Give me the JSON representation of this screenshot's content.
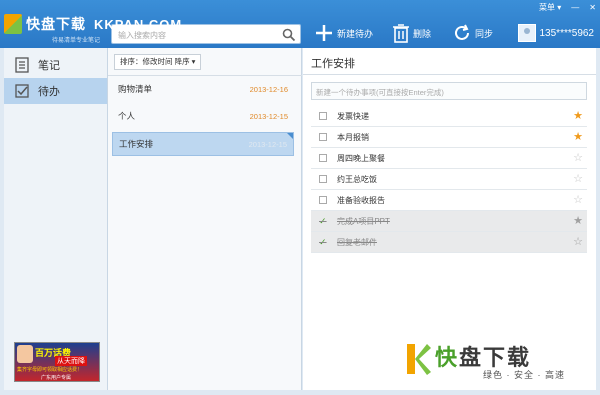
{
  "watermark": {
    "top_cn": "快盘下载",
    "top_en": "KKPAN.COM",
    "bottom_cn_a": "快",
    "bottom_cn_b": "盘下载",
    "bottom_sub": "绿色 · 安全 · 高速"
  },
  "app": {
    "subtitle": "待易清单专业笔记",
    "menu_label": "菜单 ▾"
  },
  "search": {
    "placeholder": "输入搜索内容"
  },
  "toolbar": {
    "new_label": "新建待办",
    "delete_label": "删除",
    "sync_label": "同步"
  },
  "user": {
    "name": "135****5962"
  },
  "nav": {
    "items": [
      {
        "label": "笔记"
      },
      {
        "label": "待办"
      }
    ]
  },
  "ad": {
    "t1": "百万话费",
    "t2": "从天而降",
    "t3": "集齐字母即可领取相应话费！",
    "t4": "广东用户专属"
  },
  "sort": {
    "label": "排序：修改时间  降序 ▾"
  },
  "notes": [
    {
      "title": "购物清单",
      "date": "2013-12-16"
    },
    {
      "title": "个人",
      "date": "2013-12-15"
    },
    {
      "title": "工作安排",
      "date": "2013-12-15"
    }
  ],
  "detail": {
    "title": "工作安排",
    "new_placeholder": "新建一个待办事项(可直接按Enter完成)",
    "tasks": [
      {
        "text": "发票快递",
        "done": false,
        "starred": true
      },
      {
        "text": "本月报销",
        "done": false,
        "starred": true
      },
      {
        "text": "周四晚上聚餐",
        "done": false,
        "starred": false
      },
      {
        "text": "约王总吃饭",
        "done": false,
        "starred": false
      },
      {
        "text": "准备验收报告",
        "done": false,
        "starred": false
      },
      {
        "text": "完成A项目PPT",
        "done": true,
        "starred": true
      },
      {
        "text": "回复老邮件",
        "done": true,
        "starred": false
      }
    ]
  },
  "colors": {
    "accent": "#2a78c6",
    "selected": "#bdd7f0",
    "star": "#f09a1c",
    "date": "#e08a2a"
  }
}
